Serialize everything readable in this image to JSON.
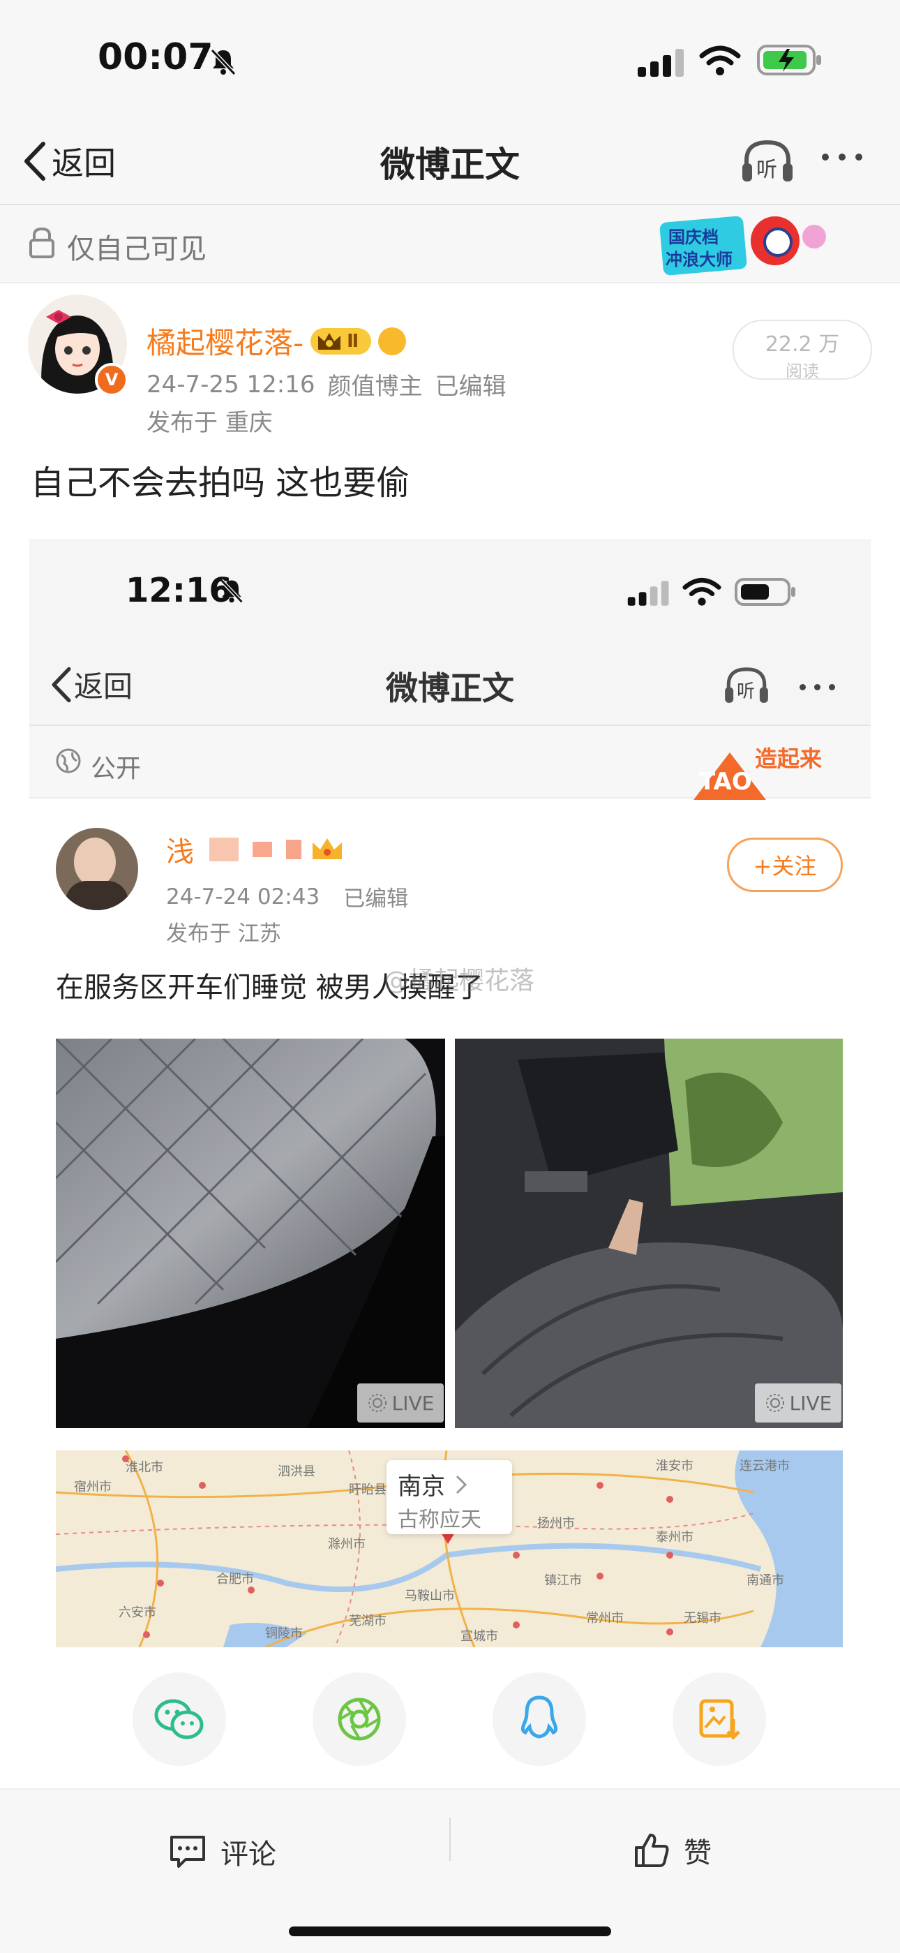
{
  "status_bar": {
    "time": "00:07"
  },
  "nav": {
    "back_label": "返回",
    "title": "微博正文",
    "listen_label": "听"
  },
  "visibility": {
    "label": "仅自己可见",
    "badge_line1": "国庆档",
    "badge_line2": "冲浪大师"
  },
  "post": {
    "author_name": "橘起樱花落-",
    "level_badge": "Ⅱ",
    "date": "24-7-25 12:16",
    "tag": "颜值博主",
    "edited": "已编辑",
    "location": "发布于 重庆",
    "reads_count": "22.2 万",
    "reads_label": "阅读",
    "text": "自己不会去拍吗 这也要偷"
  },
  "embedded": {
    "time": "12:16",
    "back_label": "返回",
    "title": "微博正文",
    "listen_label": "听",
    "visibility": "公开",
    "banner_text": "造起来",
    "banner_sub": "TAO",
    "author_name": "浅",
    "follow_label": "+关注",
    "date": "24-7-24 02:43",
    "edited": "已编辑",
    "location": "发布于 江苏",
    "text": "在服务区开车们睡觉 被男人摸醒了",
    "watermark": "@橘起樱花落",
    "live_label": "LIVE",
    "map": {
      "city": "南京",
      "subtitle": "古称应天",
      "labels": [
        "淮北市",
        "宿州市",
        "淮安市",
        "连云港市",
        "泗洪县",
        "盱眙县",
        "滁州市",
        "扬州市",
        "泰州市",
        "南通市",
        "合肥市",
        "马鞍山市",
        "镇江市",
        "常州市",
        "无锡市",
        "芜湖市",
        "宣城市",
        "六安市",
        "铜陵市"
      ]
    }
  },
  "share_icons": [
    "wechat-icon",
    "moments-icon",
    "qq-icon",
    "save-image-icon"
  ],
  "bottom_bar": {
    "comment_label": "评论",
    "like_label": "赞"
  },
  "colors": {
    "orange": "#f77b1a",
    "wechat": "#2dbd8d",
    "moments": "#6cc644",
    "qq": "#3aa7ea",
    "save": "#f7a51f"
  }
}
